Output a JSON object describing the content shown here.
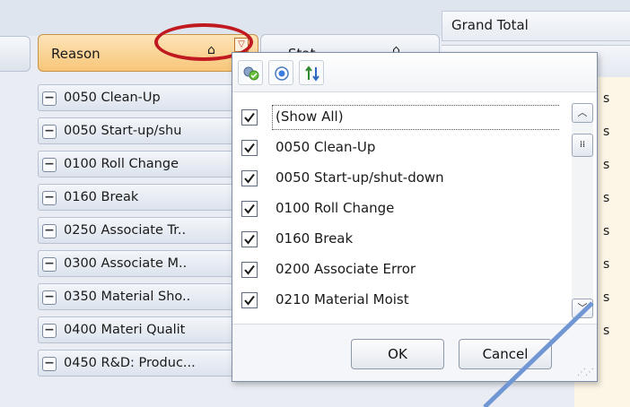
{
  "column_area": {
    "grand_total_label": "Grand Total"
  },
  "row_header": {
    "reason_label": "Reason",
    "status_label": "Stat"
  },
  "rows": [
    {
      "label": "0050  Clean-Up",
      "value": "s"
    },
    {
      "label": "0050 Start-up/shu",
      "value": "s"
    },
    {
      "label": "0100 Roll Change",
      "value": "s"
    },
    {
      "label": "0160 Break",
      "value": "s"
    },
    {
      "label": "0250 Associate Tr..",
      "value": "s"
    },
    {
      "label": "0300 Associate M..",
      "value": "s"
    },
    {
      "label": "0350 Material Sho..",
      "value": "s"
    },
    {
      "label": "0400 Materi Qualit",
      "value": "s"
    },
    {
      "label": "0450 R&D: Produc...",
      "value": ""
    }
  ],
  "filter_popup": {
    "toolbar": [
      "filter-icon",
      "radio-icon",
      "sort-icon"
    ],
    "items": [
      {
        "label": "(Show All)",
        "checked": true
      },
      {
        "label": "0050   Clean-Up",
        "checked": true
      },
      {
        "label": "0050 Start-up/shut-down",
        "checked": true
      },
      {
        "label": "0100 Roll Change",
        "checked": true
      },
      {
        "label": "0160 Break",
        "checked": true
      },
      {
        "label": "0200 Associate Error",
        "checked": true
      },
      {
        "label": "0210 Material Moist",
        "checked": true
      }
    ],
    "ok_label": "OK",
    "cancel_label": "Cancel"
  },
  "colors": {
    "header_active": "#f7c679",
    "annotation_ellipse": "#c0191f",
    "annotation_arrow": "#7096d3"
  }
}
